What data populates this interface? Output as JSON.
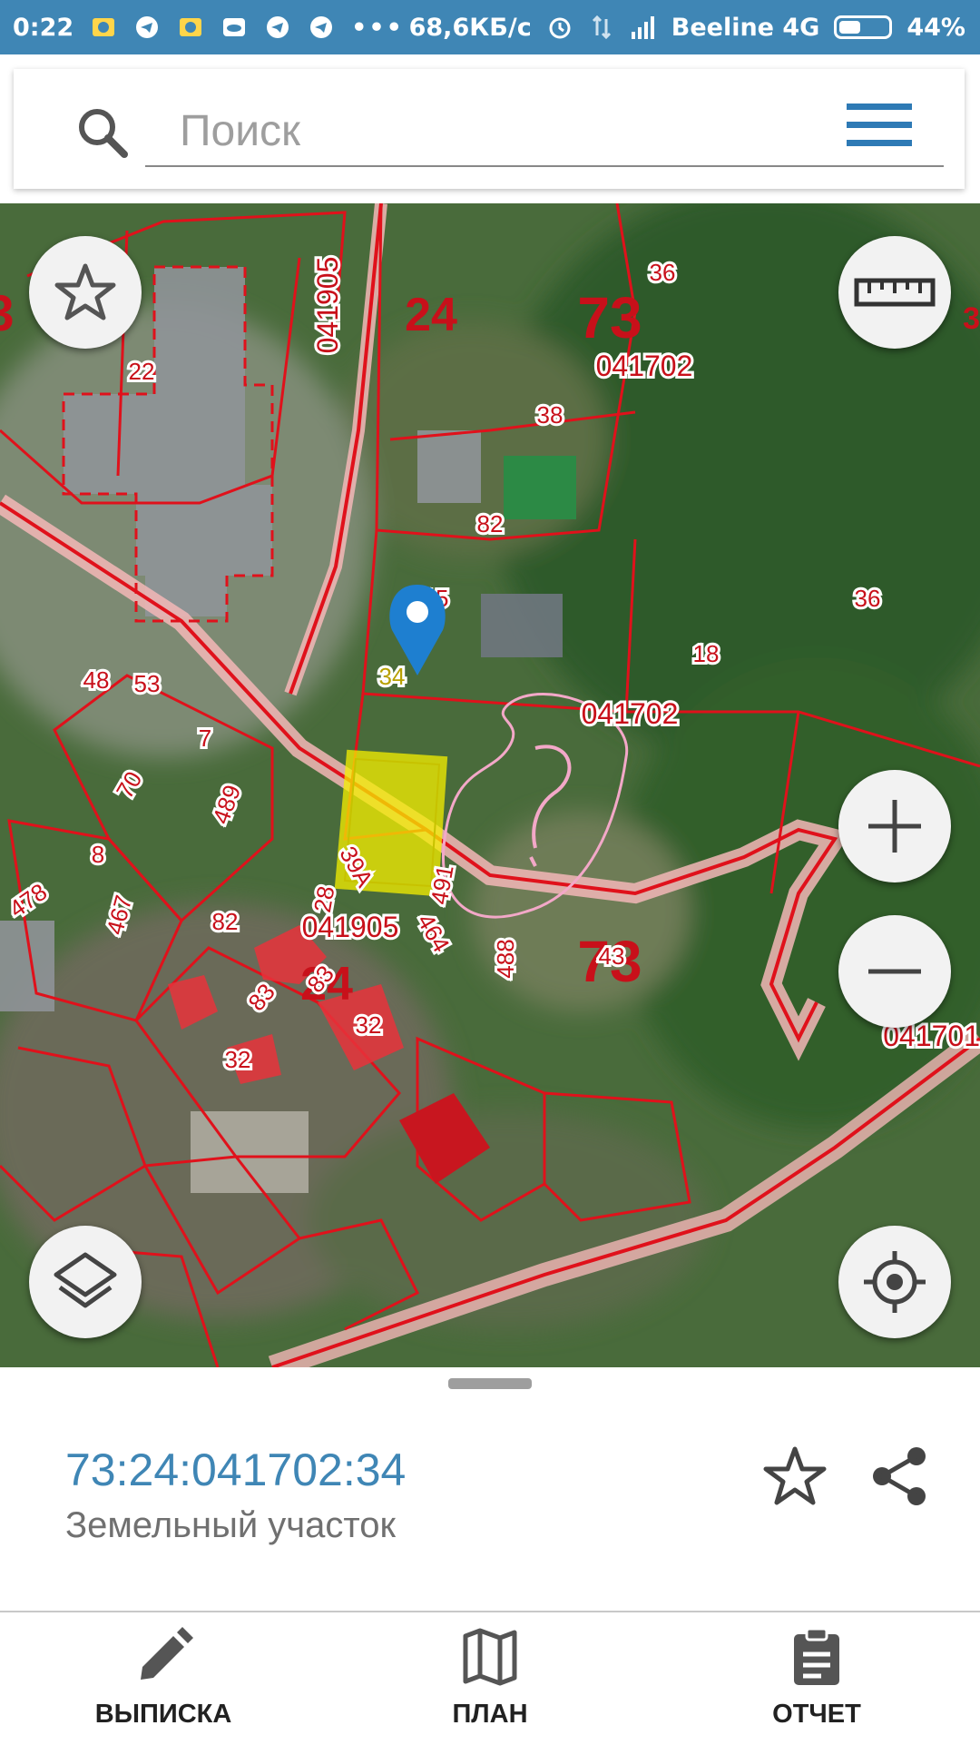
{
  "status_bar": {
    "time": "0:22",
    "net_speed": "68,6КБ/с",
    "carrier": "Beeline 4G",
    "battery": "44%",
    "battery_level": 0.44,
    "overflow": "•••"
  },
  "search": {
    "placeholder": "Поиск"
  },
  "map": {
    "labels": {
      "quarter_top": "041905",
      "district_24_top": "24",
      "region_73_top": "73",
      "quarter_702_top": "041702",
      "n36_top": "36",
      "n38": "38",
      "n22": "22",
      "n82_mid": "82",
      "n15": "15",
      "n34": "34",
      "n18": "18",
      "n36_right": "36",
      "quarter_702_mid": "041702",
      "region_73_mid": "73",
      "n48": "48",
      "n53": "53",
      "n7": "7",
      "n70": "70",
      "n489": "489",
      "district_24_mid": "24",
      "n39a": "39А",
      "n8": "8",
      "n478": "478",
      "n467": "467",
      "n82_low": "82",
      "n28": "28",
      "quarter_905_low": "041905",
      "n491": "491",
      "n464": "464",
      "n488": "488",
      "n43": "43",
      "n83a": "83",
      "n83b": "83",
      "n32a": "32",
      "n32b": "32",
      "quarter_701_right": "041701",
      "edge_left": "3",
      "edge_right": "3"
    },
    "controls": {
      "favorite": "star-icon",
      "ruler": "ruler-icon",
      "zoom_in": "plus-icon",
      "zoom_out": "minus-icon",
      "layers": "layers-icon",
      "locate": "crosshair-icon"
    },
    "colors": {
      "boundary": "#e0111b",
      "highlight": "#f5f000",
      "marker": "#1e7fd0",
      "drawing": "#f3a8c8"
    }
  },
  "parcel": {
    "number": "73:24:041702:34",
    "type": "Земельный участок"
  },
  "nav": {
    "items": [
      {
        "label": "ВЫПИСКА",
        "icon": "pencil-icon"
      },
      {
        "label": "ПЛАН",
        "icon": "map-icon"
      },
      {
        "label": "ОТЧЕТ",
        "icon": "clipboard-icon"
      }
    ]
  },
  "colors": {
    "accent": "#3f86b5",
    "status_bar": "#3f86b5"
  }
}
